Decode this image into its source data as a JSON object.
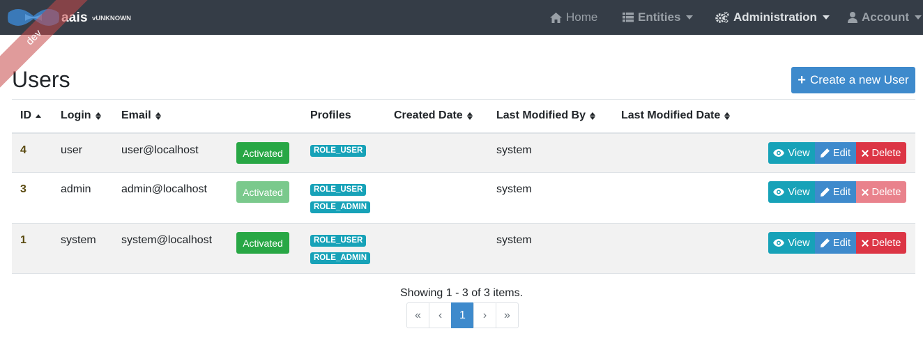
{
  "navbar": {
    "brand_name": "aais",
    "version": "vUNKNOWN",
    "ribbon": "dev",
    "items": [
      {
        "label": "Home",
        "icon": "home-icon"
      },
      {
        "label": "Entities",
        "icon": "list-icon"
      },
      {
        "label": "Administration",
        "icon": "cogs-icon"
      },
      {
        "label": "Account",
        "icon": "user-icon"
      }
    ]
  },
  "page": {
    "title": "Users",
    "create_button": "Create a new User"
  },
  "table": {
    "headers": {
      "id": "ID",
      "login": "Login",
      "email": "Email",
      "profiles": "Profiles",
      "created_date": "Created Date",
      "last_modified_by": "Last Modified By",
      "last_modified_date": "Last Modified Date"
    },
    "rows": [
      {
        "id": "4",
        "login": "user",
        "email": "user@localhost",
        "status": "Activated",
        "roles": [
          "ROLE_USER"
        ],
        "created_date": "",
        "last_modified_by": "system",
        "last_modified_date": ""
      },
      {
        "id": "3",
        "login": "admin",
        "email": "admin@localhost",
        "status": "Activated",
        "roles": [
          "ROLE_USER",
          "ROLE_ADMIN"
        ],
        "created_date": "",
        "last_modified_by": "system",
        "last_modified_date": ""
      },
      {
        "id": "1",
        "login": "system",
        "email": "system@localhost",
        "status": "Activated",
        "roles": [
          "ROLE_USER",
          "ROLE_ADMIN"
        ],
        "created_date": "",
        "last_modified_by": "system",
        "last_modified_date": ""
      }
    ],
    "actions": {
      "view": "View",
      "edit": "Edit",
      "delete": "Delete"
    }
  },
  "footer": {
    "showing": "Showing 1 - 3 of 3 items.",
    "pagination": {
      "first": "«",
      "prev": "‹",
      "current": "1",
      "next": "›",
      "last": "»"
    }
  },
  "colors": {
    "navbar": "#353d47",
    "primary": "#3e8acc",
    "success": "#28a745",
    "info": "#17a2b8",
    "danger": "#dc3545"
  }
}
